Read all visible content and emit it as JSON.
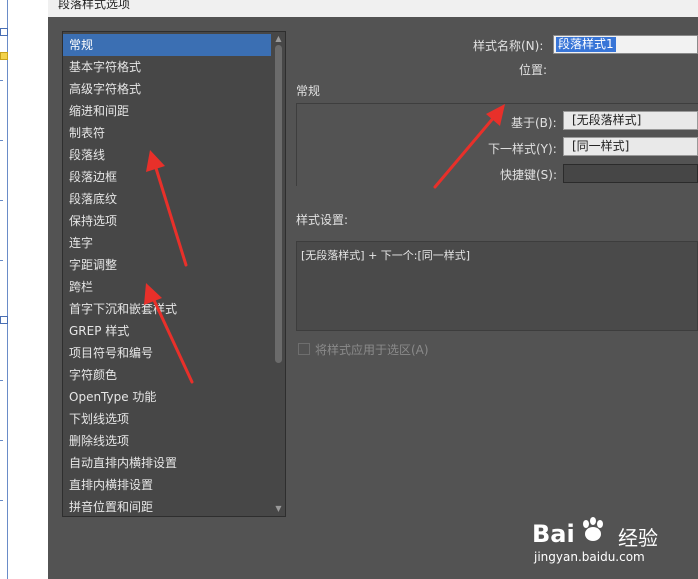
{
  "dialog": {
    "title": "段落样式选项"
  },
  "categories": [
    {
      "label": "常规",
      "selected": true
    },
    {
      "label": "基本字符格式"
    },
    {
      "label": "高级字符格式"
    },
    {
      "label": "缩进和间距"
    },
    {
      "label": "制表符"
    },
    {
      "label": "段落线"
    },
    {
      "label": "段落边框"
    },
    {
      "label": "段落底纹"
    },
    {
      "label": "保持选项"
    },
    {
      "label": "连字"
    },
    {
      "label": "字距调整"
    },
    {
      "label": "跨栏"
    },
    {
      "label": "首字下沉和嵌套样式"
    },
    {
      "label": "GREP 样式"
    },
    {
      "label": "项目符号和编号"
    },
    {
      "label": "字符颜色"
    },
    {
      "label": "OpenType 功能"
    },
    {
      "label": "下划线选项"
    },
    {
      "label": "删除线选项"
    },
    {
      "label": "自动直排内横排设置"
    },
    {
      "label": "直排内横排设置"
    },
    {
      "label": "拼音位置和间距"
    }
  ],
  "form": {
    "style_name_label": "样式名称(N):",
    "style_name_value": "段落样式1",
    "location_label": "位置:",
    "section_general": "常规",
    "based_on_label": "基于(B):",
    "based_on_value": "[无段落样式]",
    "next_style_label": "下一样式(Y):",
    "next_style_value": "[同一样式]",
    "shortcut_label": "快捷键(S):",
    "shortcut_value": "",
    "settings_label": "样式设置:",
    "settings_text": "[无段落样式] + 下一个:[同一样式]",
    "apply_label": "将样式应用于选区(A)",
    "apply_checked": false
  },
  "watermark": {
    "brand": "Bai",
    "brand_suffix": "经验",
    "url": "jingyan.baidu.com"
  },
  "colors": {
    "dialog_bg": "#535353",
    "list_bg": "#474747",
    "selection": "#3b6fb3",
    "annotation_arrow": "#e8302a"
  }
}
